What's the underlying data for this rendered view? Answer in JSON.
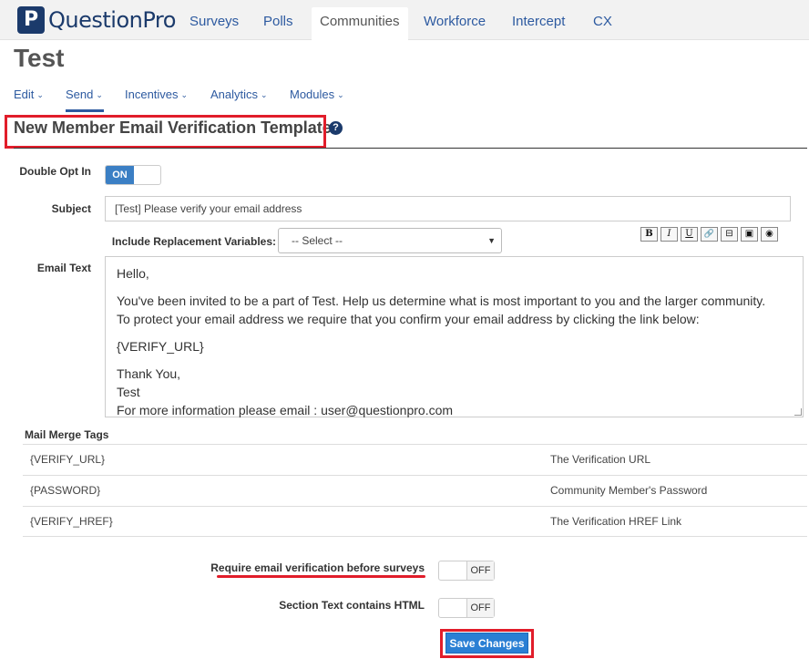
{
  "brand": {
    "logo_letter": "P",
    "logo_text": "QuestionPro"
  },
  "nav": {
    "tabs": [
      {
        "label": "Surveys"
      },
      {
        "label": "Polls"
      },
      {
        "label": "Communities"
      },
      {
        "label": "Workforce"
      },
      {
        "label": "Intercept"
      },
      {
        "label": "CX"
      }
    ],
    "active_tab": "Communities"
  },
  "page": {
    "title": "Test"
  },
  "subnav": {
    "items": [
      {
        "label": "Edit"
      },
      {
        "label": "Send"
      },
      {
        "label": "Incentives"
      },
      {
        "label": "Analytics"
      },
      {
        "label": "Modules"
      }
    ],
    "active_item": "Send",
    "caret": "⌄"
  },
  "section": {
    "heading": "New Member Email Verification Template",
    "help_glyph": "?"
  },
  "form": {
    "double_opt_in": {
      "label": "Double Opt In",
      "on_text": "ON",
      "value": "ON"
    },
    "subject": {
      "label": "Subject",
      "value": "[Test] Please verify your email address"
    },
    "replacement": {
      "label": "Include Replacement Variables:",
      "selected": "-- Select --",
      "arrow": "▼"
    },
    "toolbar": {
      "bold": "B",
      "italic": "I",
      "underline": "U",
      "link": "🔗",
      "strike": "⊟",
      "image": "▣",
      "preview": "◉"
    },
    "email_text": {
      "label": "Email Text",
      "lines": {
        "greeting": "Hello,",
        "body1": "You've been invited to be a part of Test. Help us determine what is most important to you and the larger community.",
        "body2": "To protect your email address we require that you confirm your email address by clicking the link below:",
        "url_tag": "{VERIFY_URL}",
        "signoff": "Thank You,",
        "signature": "Test",
        "info": "For more information please email : user@questionpro.com"
      }
    }
  },
  "merge_tags": {
    "title": "Mail Merge Tags",
    "rows": [
      {
        "tag": "{VERIFY_URL}",
        "description": "The Verification URL"
      },
      {
        "tag": "{PASSWORD}",
        "description": "Community Member's Password"
      },
      {
        "tag": "{VERIFY_HREF}",
        "description": "The Verification HREF Link"
      }
    ]
  },
  "settings": {
    "require_verification": {
      "label": "Require email verification before surveys",
      "off_text": "OFF",
      "value": "OFF"
    },
    "section_html": {
      "label": "Section Text contains HTML",
      "off_text": "OFF",
      "value": "OFF"
    }
  },
  "actions": {
    "save_label": "Save Changes"
  },
  "colors": {
    "accent": "#2d5aa0",
    "brand": "#1b3a6b",
    "highlight": "#e11d2a",
    "toggle_on": "#3b7fc4",
    "save_button": "#2a7fd4"
  }
}
